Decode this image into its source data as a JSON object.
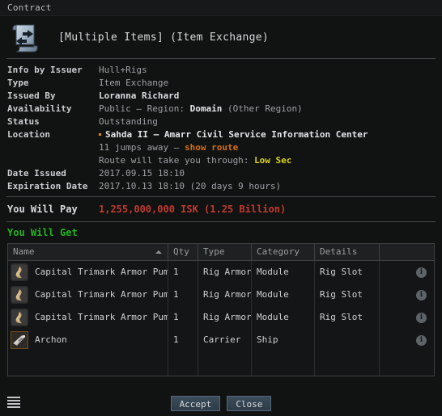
{
  "window": {
    "title": "Contract"
  },
  "header": {
    "icon": "contract-scroll-exchange-icon",
    "title": "[Multiple Items] (Item Exchange)"
  },
  "details": {
    "info_by_issuer": {
      "label": "Info by Issuer",
      "value": "Hull+Rigs"
    },
    "type": {
      "label": "Type",
      "value": "Item Exchange"
    },
    "issued_by": {
      "label": "Issued By",
      "value": "Loranna Richard"
    },
    "availability": {
      "label": "Availability",
      "prefix": "Public – Region:",
      "region": "Domain",
      "suffix": "(Other Region)"
    },
    "status": {
      "label": "Status",
      "value": "Outstanding"
    },
    "location": {
      "label": "Location",
      "name": "Sahda II – Amarr Civil Service Information Center",
      "jumps": "11 jumps away –",
      "show_route_link": "show route",
      "route_prefix": "Route will take you through:",
      "route_security": "Low Sec"
    },
    "date_issued": {
      "label": "Date Issued",
      "value": "2017.09.15 18:10"
    },
    "expiration_date": {
      "label": "Expiration Date",
      "value": "2017.10.13 18:10 (20 days 9 hours)"
    }
  },
  "pay": {
    "label": "You Will Pay",
    "amount": "1,255,000,000 ISK (1.25 Billion)"
  },
  "get": {
    "heading": "You Will Get",
    "columns": {
      "name": "Name",
      "qty": "Qty",
      "type": "Type",
      "category": "Category",
      "details": "Details",
      "info": ""
    },
    "sort_indicator": "sort-ascending-icon",
    "rows": [
      {
        "icon": "rig-armor-module-icon",
        "name": "Capital Trimark Armor Pump I",
        "qty": "1",
        "type": "Rig Armor",
        "category": "Module",
        "details": "Rig Slot",
        "info": "i"
      },
      {
        "icon": "rig-armor-module-icon",
        "name": "Capital Trimark Armor Pump I",
        "qty": "1",
        "type": "Rig Armor",
        "category": "Module",
        "details": "Rig Slot",
        "info": "i"
      },
      {
        "icon": "rig-armor-module-icon",
        "name": "Capital Trimark Armor Pump I",
        "qty": "1",
        "type": "Rig Armor",
        "category": "Module",
        "details": "Rig Slot",
        "info": "i"
      },
      {
        "icon": "carrier-ship-icon",
        "name": "Archon",
        "qty": "1",
        "type": "Carrier",
        "category": "Ship",
        "details": "",
        "info": "i"
      }
    ]
  },
  "footer": {
    "menu_icon": "hamburger-menu-icon",
    "accept_label": "Accept",
    "close_label": "Close"
  },
  "colors": {
    "background": "#111212",
    "pay_red": "#c23a30",
    "get_green": "#21b521",
    "link_orange": "#d2700f",
    "lowsec_yellow": "#d9d317",
    "location_dot": "#e08a1e"
  }
}
